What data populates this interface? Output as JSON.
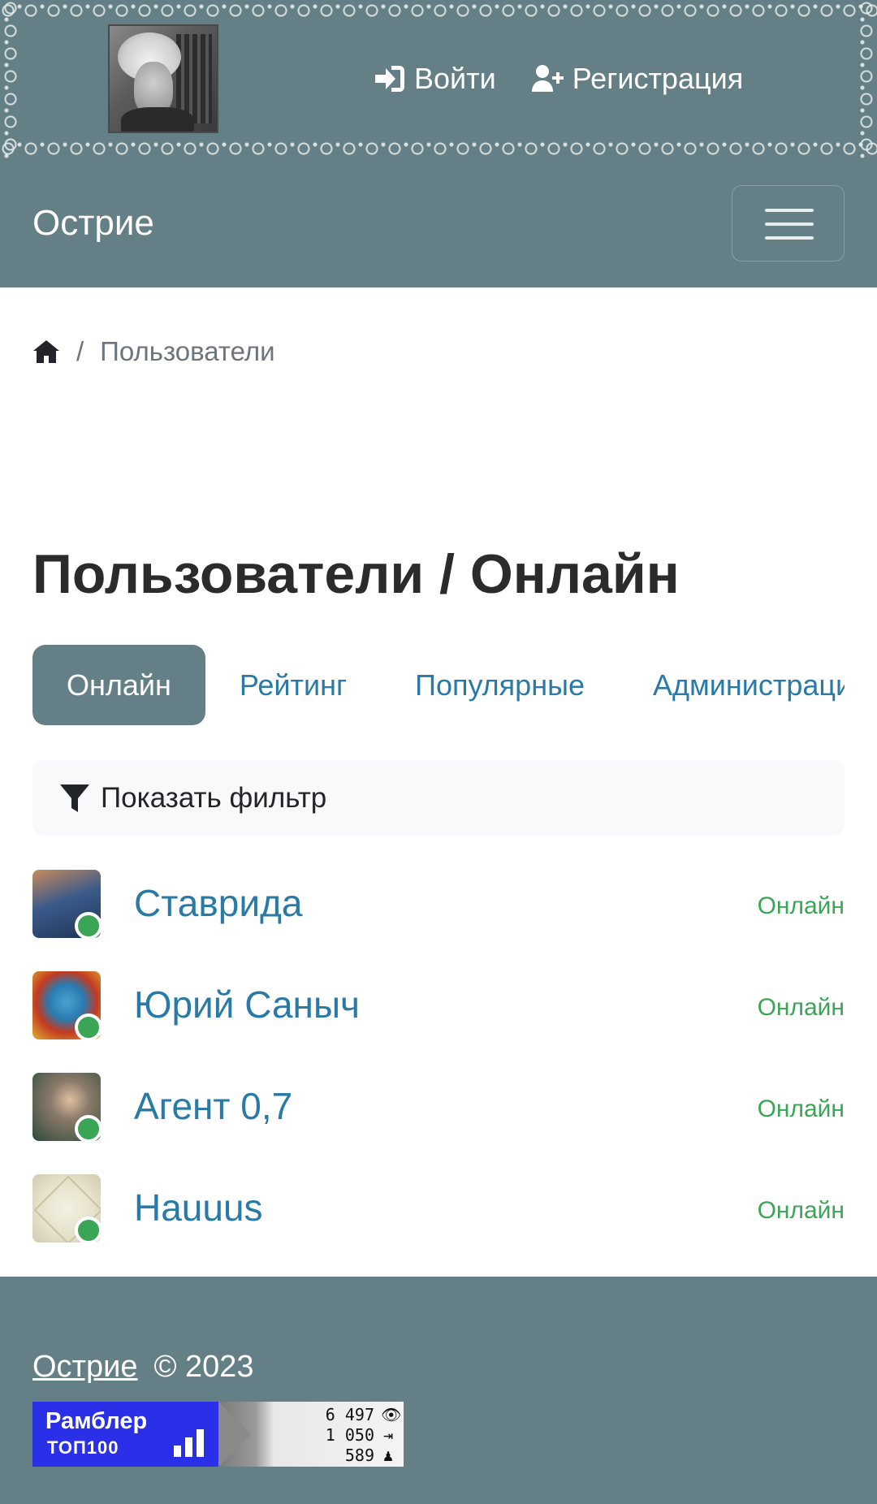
{
  "header": {
    "login_label": "Войти",
    "register_label": "Регистрация"
  },
  "navbar": {
    "brand": "Острие"
  },
  "breadcrumb": {
    "separator": "/",
    "current": "Пользователи"
  },
  "page": {
    "title": "Пользователи / Онлайн"
  },
  "tabs": [
    {
      "label": "Онлайн",
      "active": true
    },
    {
      "label": "Рейтинг",
      "active": false
    },
    {
      "label": "Популярные",
      "active": false
    },
    {
      "label": "Администрация",
      "active": false
    }
  ],
  "filter": {
    "label": "Показать фильтр"
  },
  "users": [
    {
      "name": "Ставрида",
      "status": "Онлайн"
    },
    {
      "name": "Юрий Саныч",
      "status": "Онлайн"
    },
    {
      "name": "Агент 0,7",
      "status": "Онлайн"
    },
    {
      "name": "Hauuus",
      "status": "Онлайн"
    }
  ],
  "footer": {
    "site_link": "Острие",
    "copyright": "© 2023",
    "counter": {
      "line1": "Рамблер",
      "line2": "ТОП100",
      "views": "6 497",
      "visits": "1 050",
      "visitors": "589"
    }
  },
  "colors": {
    "header_bg": "#647f85",
    "link": "#2a7aa8",
    "online": "#3aa655"
  }
}
